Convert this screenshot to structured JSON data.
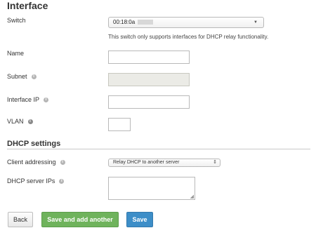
{
  "section_interface": {
    "title": "Interface"
  },
  "switch": {
    "label": "Switch",
    "value": "00:18:0a",
    "helptext": "This switch only supports interfaces for DHCP relay functionality."
  },
  "fields": {
    "name_label": "Name",
    "subnet_label": "Subnet",
    "interface_ip_label": "Interface IP",
    "vlan_label": "VLAN"
  },
  "section_dhcp": {
    "title": "DHCP settings"
  },
  "dhcp": {
    "client_addressing_label": "Client addressing",
    "client_addressing_value": "Relay DHCP to another server",
    "server_ips_label": "DHCP server IPs"
  },
  "buttons": {
    "back": "Back",
    "save_and_add": "Save and add another",
    "save": "Save"
  },
  "colors": {
    "save_and_add_bg": "#6fb35c",
    "save_bg": "#3d8ec8"
  }
}
